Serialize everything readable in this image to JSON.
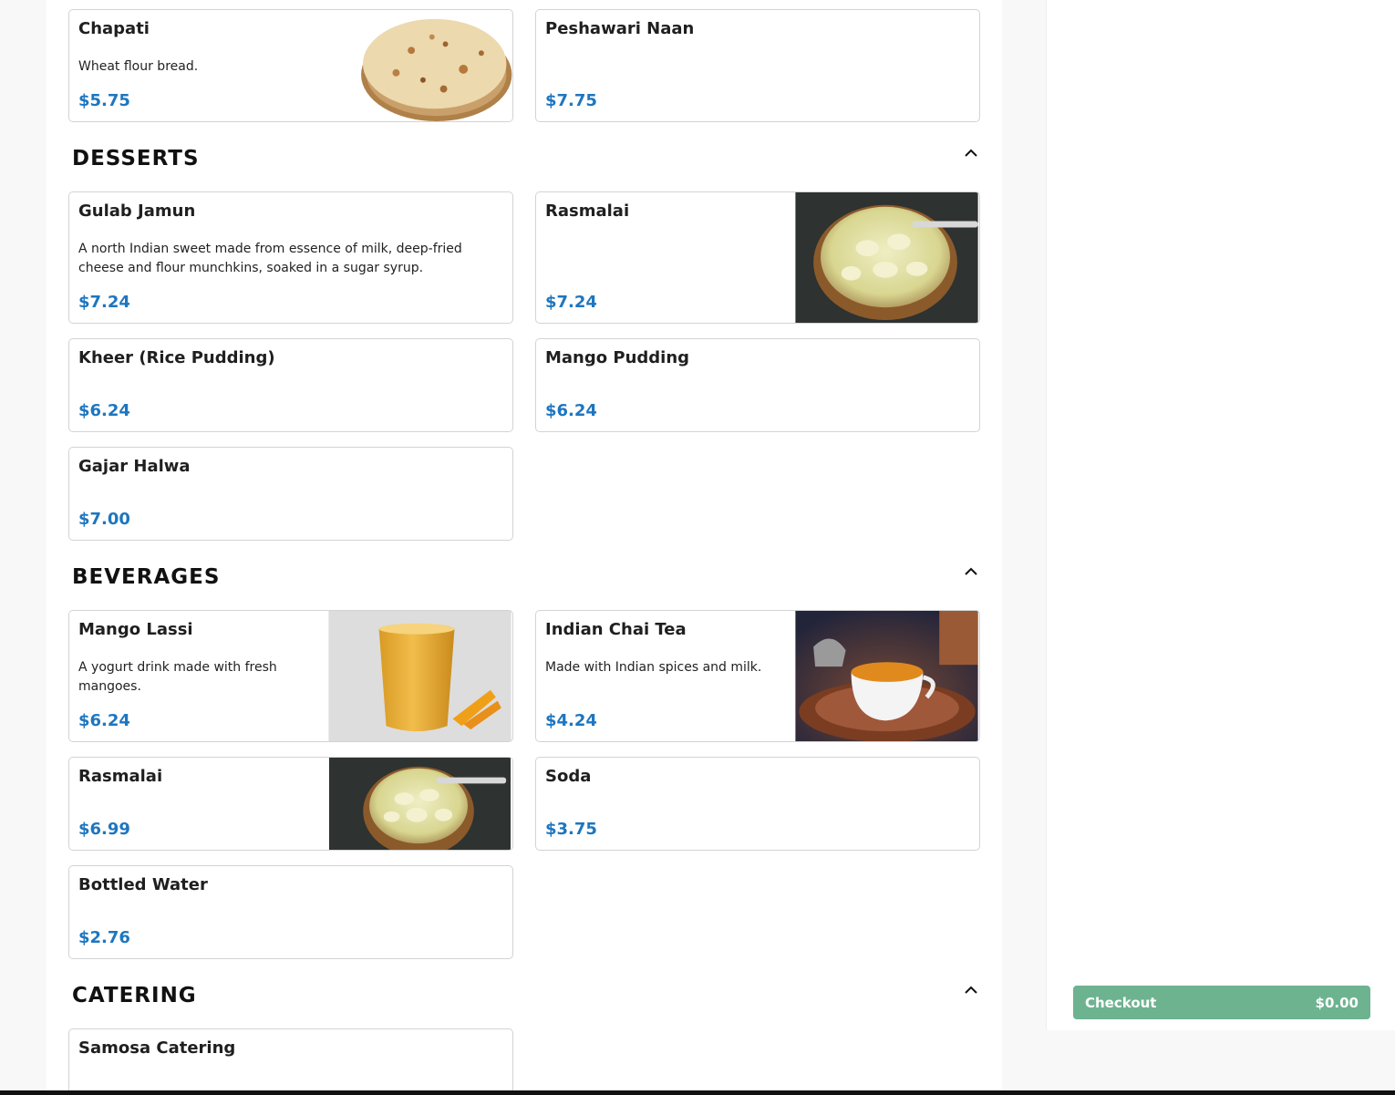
{
  "colors": {
    "price": "#1e76bf",
    "checkout": "#6db390"
  },
  "sections": {
    "breads": {
      "items": [
        {
          "name": "Chapati",
          "description": "Wheat flour bread.",
          "price": "$5.75",
          "image": "chapati-image"
        },
        {
          "name": "Peshawari Naan",
          "price": "$7.75"
        }
      ]
    },
    "desserts": {
      "title": "DESSERTS",
      "items": [
        {
          "name": "Gulab Jamun",
          "description": "A north Indian sweet made from essence of milk, deep-fried cheese and flour munchkins, soaked in a sugar syrup.",
          "price": "$7.24"
        },
        {
          "name": "Rasmalai",
          "price": "$7.24",
          "image": "rasmalai-image"
        },
        {
          "name": "Kheer (Rice Pudding)",
          "price": "$6.24"
        },
        {
          "name": "Mango Pudding",
          "price": "$6.24"
        },
        {
          "name": "Gajar Halwa",
          "price": "$7.00"
        }
      ]
    },
    "beverages": {
      "title": "BEVERAGES",
      "items": [
        {
          "name": "Mango Lassi",
          "description": "A yogurt drink made with fresh mangoes.",
          "price": "$6.24",
          "image": "mango-lassi-image"
        },
        {
          "name": "Indian Chai Tea",
          "description": "Made with Indian spices and milk.",
          "price": "$4.24",
          "image": "chai-tea-image"
        },
        {
          "name": "Rasmalai",
          "price": "$6.99",
          "image": "rasmalai-image"
        },
        {
          "name": "Soda",
          "price": "$3.75"
        },
        {
          "name": "Bottled Water",
          "price": "$2.76"
        }
      ]
    },
    "catering": {
      "title": "CATERING",
      "items": [
        {
          "name": "Samosa Catering"
        }
      ]
    }
  },
  "icons": {
    "collapse": "chevron-up-icon"
  },
  "cart": {
    "checkout_label": "Checkout",
    "total": "$0.00"
  }
}
